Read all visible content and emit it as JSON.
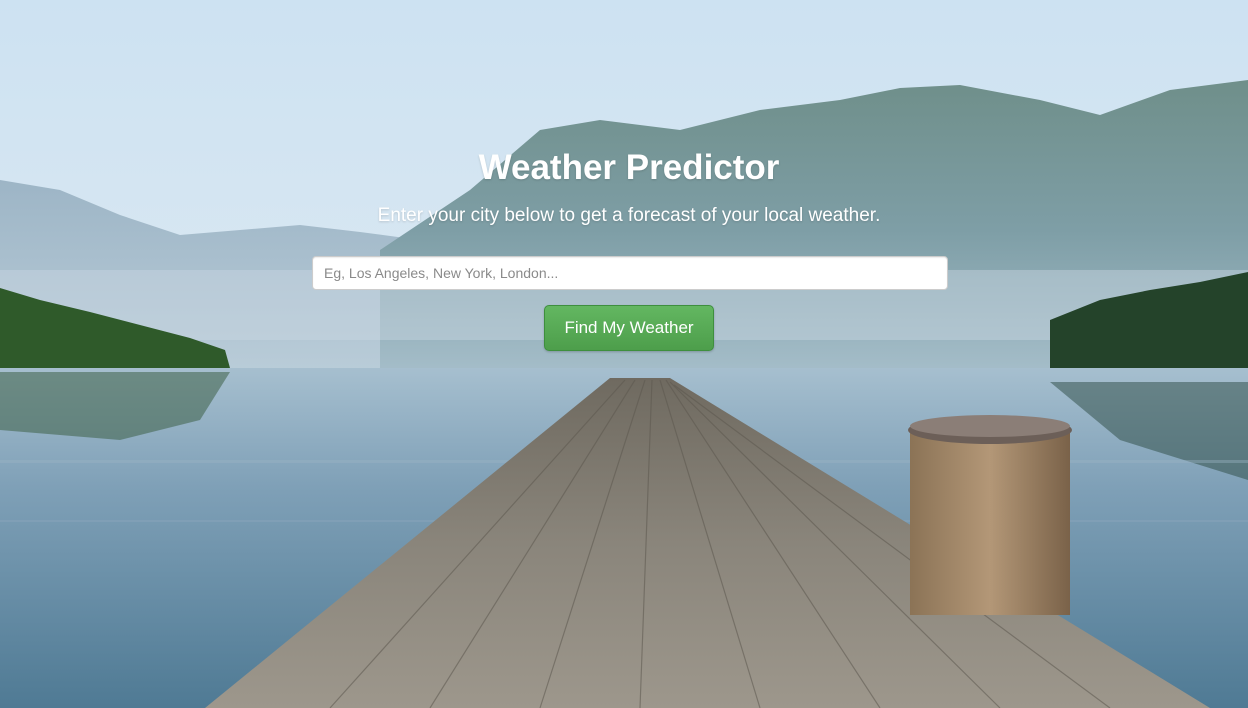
{
  "hero": {
    "title": "Weather Predictor",
    "subtitle": "Enter your city below to get a forecast of your local weather."
  },
  "search": {
    "placeholder": "Eg, Los Angeles, New York, London...",
    "value": ""
  },
  "actions": {
    "find_label": "Find My Weather"
  },
  "colors": {
    "button": "#5cb85c",
    "text": "#ffffff"
  }
}
